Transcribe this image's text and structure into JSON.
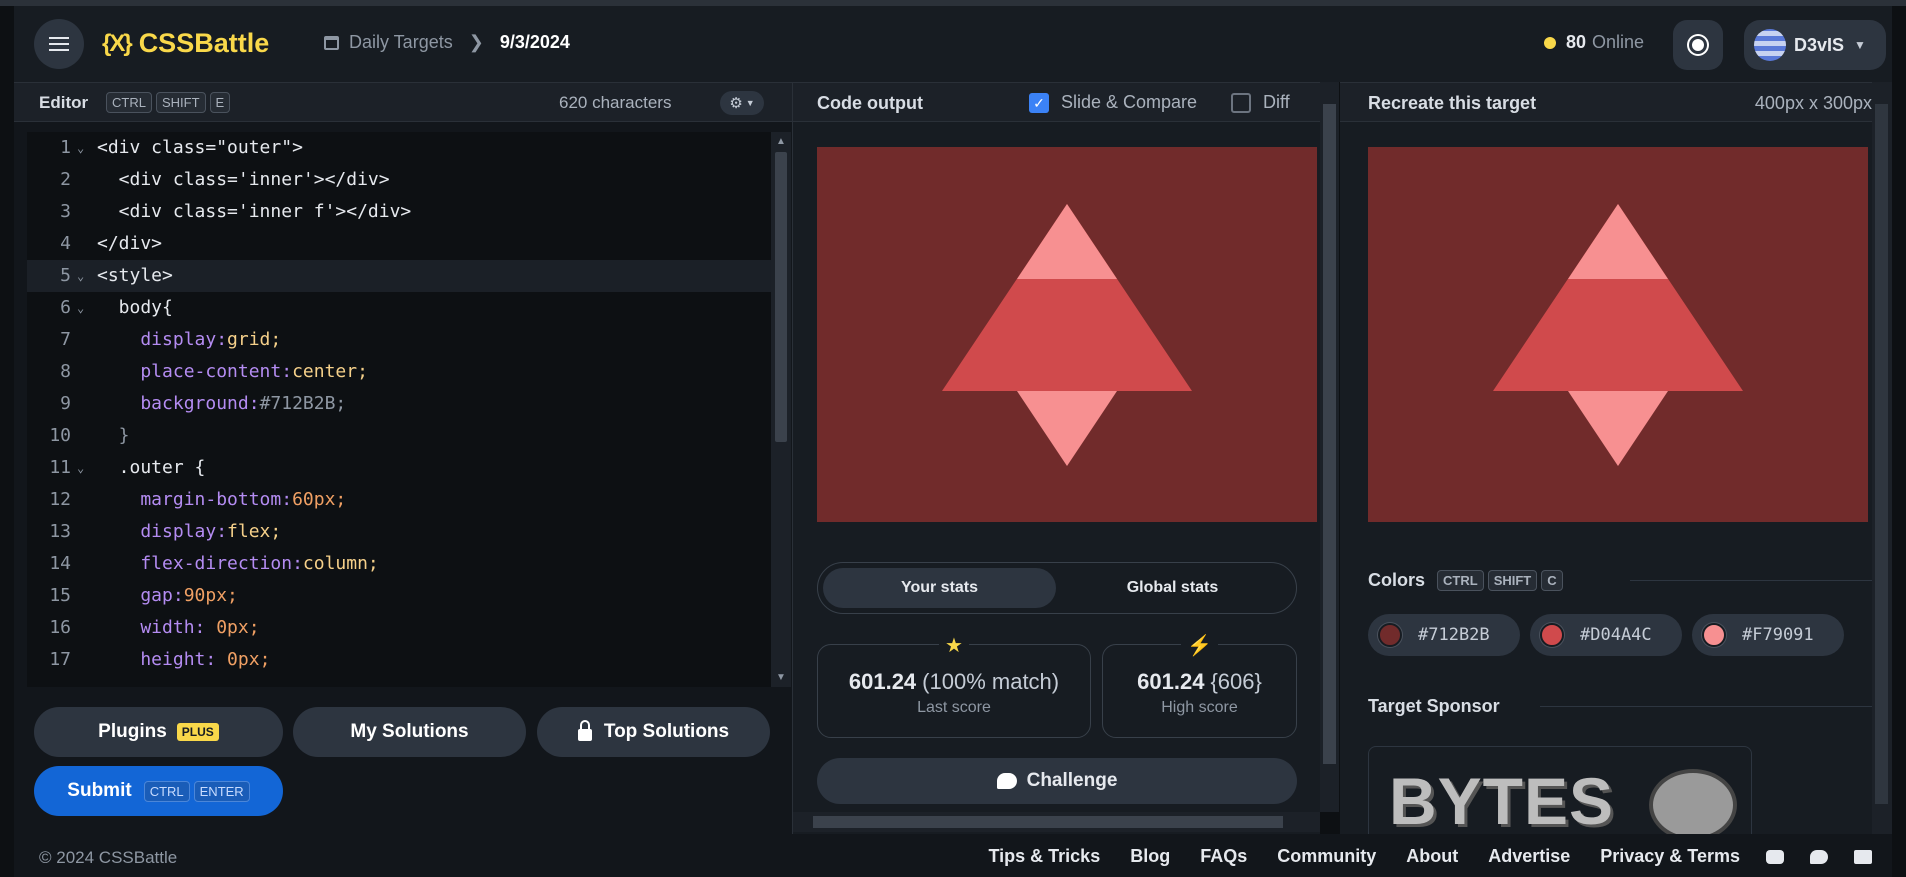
{
  "header": {
    "logo_icon": "{X}",
    "logo_text": "CSSBattle",
    "breadcrumb_parent": "Daily Targets",
    "breadcrumb_current": "9/3/2024",
    "online_count": "80",
    "online_label": "Online",
    "username": "D3vIS"
  },
  "editor": {
    "title": "Editor",
    "shortcut": [
      "CTRL",
      "SHIFT",
      "E"
    ],
    "char_count": "620 characters",
    "code_lines": [
      {
        "n": "1",
        "fold": true
      },
      {
        "n": "2",
        "fold": false
      },
      {
        "n": "3",
        "fold": false
      },
      {
        "n": "4",
        "fold": false
      },
      {
        "n": "5",
        "fold": true
      },
      {
        "n": "6",
        "fold": true
      },
      {
        "n": "7",
        "fold": false
      },
      {
        "n": "8",
        "fold": false
      },
      {
        "n": "9",
        "fold": false
      },
      {
        "n": "10",
        "fold": false
      },
      {
        "n": "11",
        "fold": true
      },
      {
        "n": "12",
        "fold": false
      },
      {
        "n": "13",
        "fold": false
      },
      {
        "n": "14",
        "fold": false
      },
      {
        "n": "15",
        "fold": false
      },
      {
        "n": "16",
        "fold": false
      },
      {
        "n": "17",
        "fold": false
      }
    ],
    "code_text": {
      "l1": "<div class=\"outer\">",
      "l2": "  <div class='inner'></div>",
      "l3": "  <div class='inner f'></div>",
      "l4": "</div>",
      "l5": "<style>",
      "l6": "  body{",
      "l7a": "    display:",
      "l7b": "grid;",
      "l8a": "    place-content:",
      "l8b": "center;",
      "l9a": "    background:",
      "l9b": "#712B2B;",
      "l10": "  }",
      "l11": "  .outer {",
      "l12a": "    margin-bottom:",
      "l12b": "60px;",
      "l13a": "    display:",
      "l13b": "flex;",
      "l14a": "    flex-direction:",
      "l14b": "column;",
      "l15a": "    gap:",
      "l15b": "90px;",
      "l16a": "    width:",
      "l16b": " 0px;",
      "l17a": "    height:",
      "l17b": " 0px;"
    },
    "buttons": {
      "plugins": "Plugins",
      "plus_badge": "PLUS",
      "my_solutions": "My Solutions",
      "top_solutions": "Top Solutions",
      "submit": "Submit",
      "submit_keys": [
        "CTRL",
        "ENTER"
      ]
    }
  },
  "output": {
    "title": "Code output",
    "slide_compare_label": "Slide & Compare",
    "slide_compare_checked": true,
    "diff_label": "Diff",
    "diff_checked": false,
    "tabs": [
      "Your stats",
      "Global stats"
    ],
    "active_tab": "Your stats",
    "last_score_value": "601.24",
    "last_score_match": "(100% match)",
    "last_score_label": "Last score",
    "high_score_value": "601.24",
    "high_score_extra": "{606}",
    "high_score_label": "High score",
    "challenge_label": "Challenge"
  },
  "target": {
    "title": "Recreate this target",
    "dimensions": "400px x 300px",
    "colors_title": "Colors",
    "colors_shortcut": [
      "CTRL",
      "SHIFT",
      "C"
    ],
    "colors": [
      {
        "hex": "#712B2B",
        "color": "#712B2B"
      },
      {
        "hex": "#D04A4C",
        "color": "#D04A4C"
      },
      {
        "hex": "#F79091",
        "color": "#F79091"
      }
    ],
    "sponsor_title": "Target Sponsor",
    "sponsor_logo_text": "BYTES"
  },
  "palette": {
    "bg": "#712B2B",
    "mid": "#D04A4C",
    "light": "#F79091",
    "accent": "#F9D84A",
    "submit": "#1366D6"
  },
  "footer": {
    "copyright": "© 2024 CSSBattle",
    "links": [
      "Tips & Tricks",
      "Blog",
      "FAQs",
      "Community",
      "About",
      "Advertise",
      "Privacy & Terms"
    ],
    "social_icons": [
      "discord-icon",
      "twitter-icon",
      "mail-icon"
    ]
  }
}
